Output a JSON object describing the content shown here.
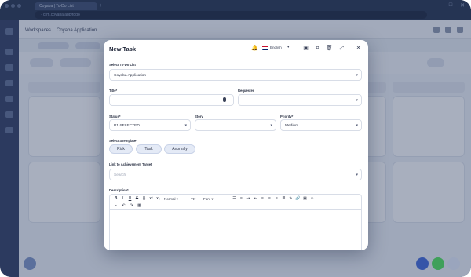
{
  "browser": {
    "tab_title": "Coyaba | To-Do List",
    "address": "· crm.coyaba.app/todo"
  },
  "background": {
    "breadcrumb_1": "Workspaces",
    "breadcrumb_2": "Coyaba Application",
    "toolbar_tab": "To-Do List"
  },
  "modal": {
    "title": "New Task",
    "language": "English",
    "icons": [
      "bell-icon",
      "uk-flag-icon",
      "chevron-down-icon",
      "save-icon",
      "copy-icon",
      "trash-icon",
      "expand-icon",
      "close-icon"
    ],
    "todo_list": {
      "label": "Select To-Do List",
      "value": "Coyaba Application"
    },
    "title_field": {
      "label": "Title",
      "required": "*",
      "value": ""
    },
    "requester": {
      "label": "Requester",
      "value": ""
    },
    "status": {
      "label": "Status",
      "required": "*",
      "value": "P1-SELECTED"
    },
    "story": {
      "label": "Story",
      "value": ""
    },
    "priority": {
      "label": "Priority",
      "required": "*",
      "value": "Medium"
    },
    "template": {
      "label": "Select a template",
      "required": "*",
      "options": [
        "Risk",
        "Task",
        "Anomaly"
      ]
    },
    "achievement": {
      "label": "Link to Achievement Target",
      "placeholder": "Search"
    },
    "description": {
      "label": "Description",
      "required": "*",
      "toolbar_row1": [
        "B",
        "I",
        "U",
        "S",
        "{}",
        "x²",
        "x₂"
      ],
      "paragraph_style": "Normal",
      "size_label": "Tt",
      "font_label": "Font",
      "toolbar_row1_tail": [
        "list-icon",
        "ordered-list-icon",
        "indent-icon",
        "outdent-icon",
        "align-left-icon",
        "align-center-icon",
        "align-right-icon",
        "justify-icon",
        "pen-icon",
        "link-icon",
        "image-icon",
        "emoji-icon"
      ],
      "toolbar_row2": [
        "clear-icon",
        "undo-icon",
        "redo-icon",
        "table-icon"
      ]
    }
  }
}
